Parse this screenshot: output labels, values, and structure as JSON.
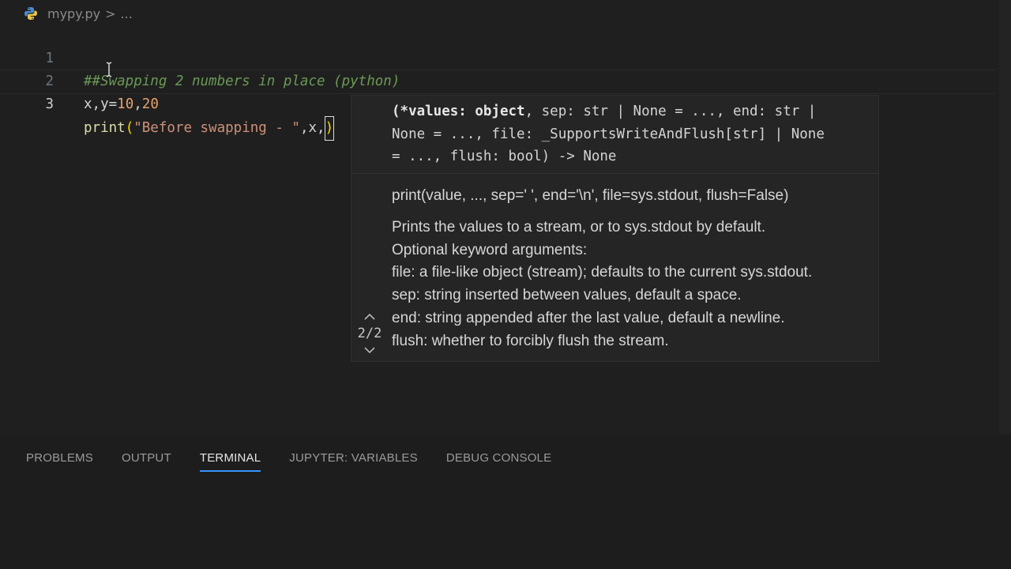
{
  "breadcrumb": {
    "file": "mypy.py",
    "sep": ">",
    "rest": "..."
  },
  "code": {
    "lines": [
      {
        "no": "1",
        "comment": "##Swapping 2 numbers in place (python)"
      },
      {
        "no": "2",
        "vars": "x,y",
        "eq": "=",
        "v1": "10",
        "comma": ",",
        "v2": "20"
      },
      {
        "no": "3",
        "fn": "print",
        "open": "(",
        "str": "\"Before swapping - \"",
        "args": ",x,",
        "close": ")"
      }
    ]
  },
  "hover": {
    "signature": [
      {
        "bold": "(*values: object",
        "rest": ", sep: str | None = ..., end: str |"
      },
      {
        "text": "None = ..., file: _SupportsWriteAndFlush[str] | None"
      },
      {
        "text": "= ..., flush: bool) -> None"
      }
    ],
    "doc": [
      "print(value, ..., sep=' ', end='\\n', file=sys.stdout, flush=False)",
      "Prints the values to a stream, or to sys.stdout by default.",
      "Optional keyword arguments:",
      "file: a file-like object (stream); defaults to the current sys.stdout.",
      "sep: string inserted between values, default a space.",
      "end: string appended after the last value, default a newline.",
      "flush: whether to forcibly flush the stream."
    ],
    "pager": "2/2"
  },
  "panel": {
    "tabs": [
      "PROBLEMS",
      "OUTPUT",
      "TERMINAL",
      "JUPYTER: VARIABLES",
      "DEBUG CONSOLE"
    ],
    "active_tab": "TERMINAL"
  },
  "colors": {
    "accent": "#3794ff",
    "comment": "#6a9955",
    "number": "#e9a26b",
    "string": "#ce9178",
    "function": "#dcdcaa"
  }
}
